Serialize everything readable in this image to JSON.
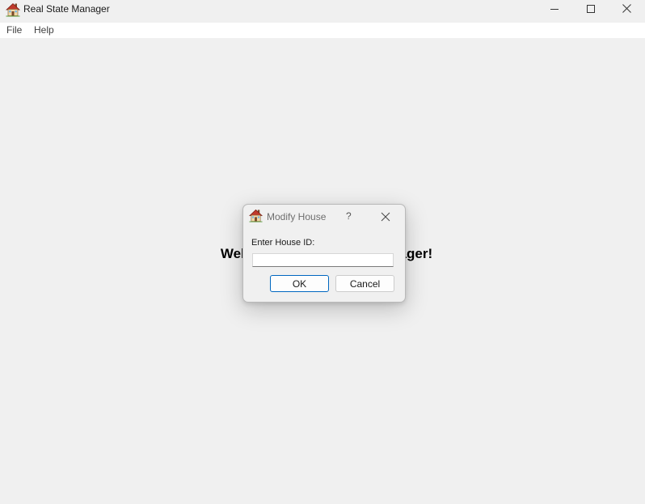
{
  "window": {
    "title": "Real State Manager"
  },
  "menu": {
    "items": [
      {
        "label": "File"
      },
      {
        "label": "Help"
      }
    ]
  },
  "main": {
    "welcome_text": "Welcome to Real State Manager!"
  },
  "dialog": {
    "title": "Modify House",
    "help_label": "?",
    "prompt_label": "Enter House ID:",
    "input_value": "",
    "ok_label": "OK",
    "cancel_label": "Cancel"
  },
  "icons": {
    "app": "house-icon",
    "dialog": "house-icon",
    "minimize": "minimize-icon",
    "maximize": "maximize-icon",
    "close": "close-icon",
    "dialog_close": "close-icon"
  },
  "colors": {
    "background": "#f0f0f0",
    "menubar": "#ffffff",
    "default_button_border": "#0067c0",
    "house_roof": "#c0392b",
    "house_wall": "#f2d7a6"
  }
}
